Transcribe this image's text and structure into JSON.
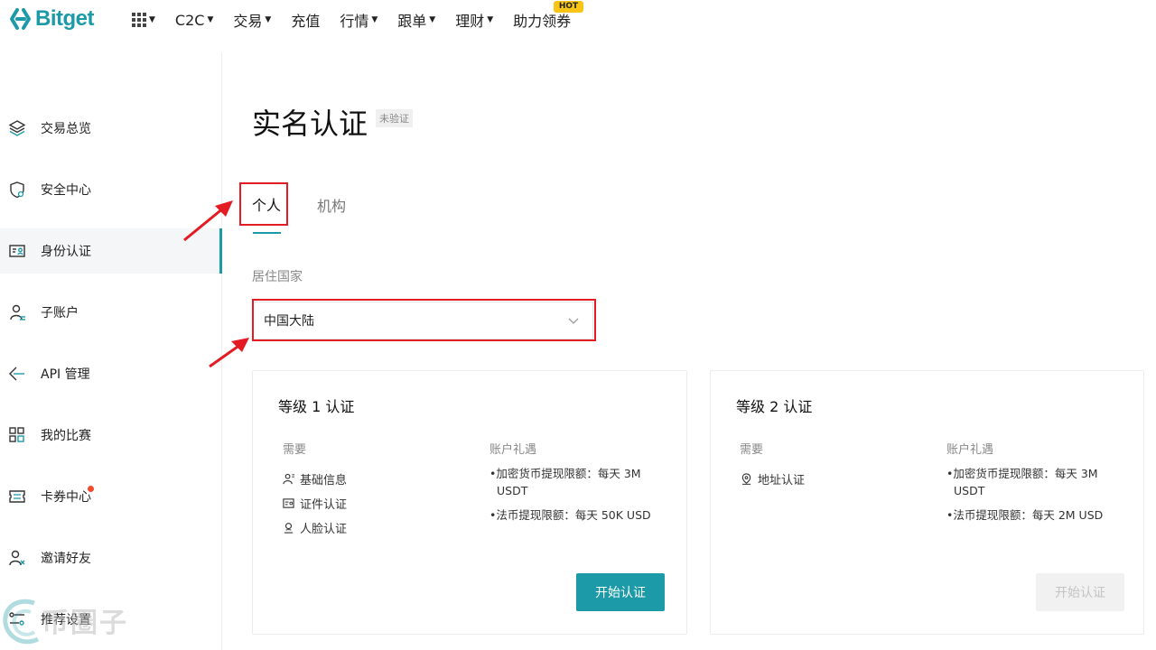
{
  "brand": {
    "name": "Bitget",
    "color": "#1c9aa7"
  },
  "nav": {
    "items": [
      {
        "label": "C2C",
        "has_caret": true
      },
      {
        "label": "交易",
        "has_caret": true
      },
      {
        "label": "充值",
        "has_caret": false
      },
      {
        "label": "行情",
        "has_caret": true
      },
      {
        "label": "跟单",
        "has_caret": true
      },
      {
        "label": "理财",
        "has_caret": true
      },
      {
        "label": "助力领券",
        "has_caret": false,
        "badge": "HOT"
      }
    ]
  },
  "sidebar": {
    "items": [
      {
        "label": "交易总览",
        "icon": "layers-icon"
      },
      {
        "label": "安全中心",
        "icon": "shield-icon"
      },
      {
        "label": "身份认证",
        "icon": "id-card-icon",
        "active": true
      },
      {
        "label": "子账户",
        "icon": "sub-account-icon"
      },
      {
        "label": "API 管理",
        "icon": "api-icon"
      },
      {
        "label": "我的比赛",
        "icon": "grid-icon"
      },
      {
        "label": "卡券中心",
        "icon": "coupon-icon",
        "dot": true
      },
      {
        "label": "邀请好友",
        "icon": "invite-icon"
      },
      {
        "label": "推荐设置",
        "icon": "settings-icon"
      }
    ]
  },
  "main": {
    "title": "实名认证",
    "status_badge": "未验证",
    "tabs": [
      {
        "label": "个人",
        "active": true
      },
      {
        "label": "机构",
        "active": false
      }
    ],
    "country_label": "居住国家",
    "country_value": "中国大陆"
  },
  "cards": [
    {
      "title": "等级 1 认证",
      "requirements_header": "需要",
      "benefits_header": "账户礼遇",
      "requirements": [
        {
          "label": "基础信息",
          "icon": "user-icon"
        },
        {
          "label": "证件认证",
          "icon": "id-card-icon"
        },
        {
          "label": "人脸认证",
          "icon": "face-icon"
        }
      ],
      "benefits": [
        "加密货币提现限额：每天 3M USDT",
        "法币提现限额：每天 50K USD"
      ],
      "button": "开始认证",
      "button_enabled": true
    },
    {
      "title": "等级 2 认证",
      "requirements_header": "需要",
      "benefits_header": "账户礼遇",
      "requirements": [
        {
          "label": "地址认证",
          "icon": "location-icon"
        }
      ],
      "benefits": [
        "加密货币提现限额：每天 3M USDT",
        "法币提现限额：每天 2M USD"
      ],
      "button": "开始认证",
      "button_enabled": false
    }
  ],
  "watermark": {
    "text": "币圈子"
  },
  "colors": {
    "accent": "#1c9aa7",
    "highlight": "#e31b23",
    "hot_badge": "#f8c516",
    "dot": "#f04a2a"
  }
}
